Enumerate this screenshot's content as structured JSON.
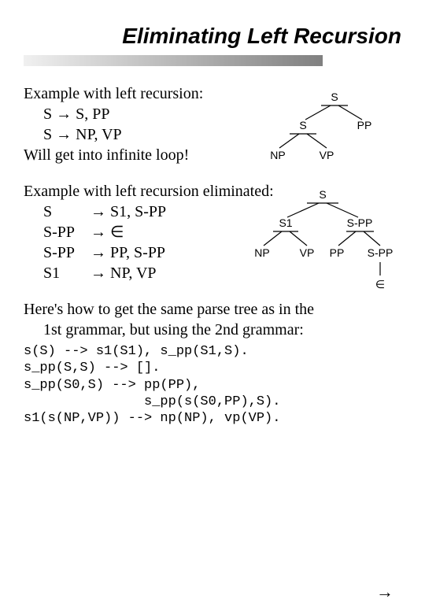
{
  "title": "Eliminating Left Recursion",
  "section1": {
    "heading": "Example with left recursion:",
    "rules": [
      {
        "lhs": "S",
        "rhs": "S, PP"
      },
      {
        "lhs": "S",
        "rhs": "NP, VP"
      }
    ],
    "footer": "Will get into infinite loop!"
  },
  "tree1": {
    "n1": "S",
    "n2": "S",
    "n3": "PP",
    "n4": "NP",
    "n5": "VP"
  },
  "section2": {
    "heading": "Example with left recursion eliminated:",
    "rules": [
      {
        "lhs": "S",
        "rhs": "S1, S-PP"
      },
      {
        "lhs": "S-PP",
        "rhs": "∈"
      },
      {
        "lhs": "S-PP",
        "rhs": "PP, S-PP"
      },
      {
        "lhs": "S1",
        "rhs": "NP, VP"
      }
    ]
  },
  "tree2": {
    "n1": "S",
    "n2": "S1",
    "n3": "S-PP",
    "n4": "NP",
    "n5": "VP",
    "n6": "PP",
    "n7": "S-PP",
    "n8": "∈"
  },
  "section3": {
    "heading_a": "Here's how to get the same parse tree as in the",
    "heading_b": "1st grammar, but using the 2nd grammar:"
  },
  "code": {
    "l1": "s(S) --> s1(S1), s_pp(S1,S).",
    "l2": "s_pp(S,S) --> [].",
    "l3": "s_pp(S0,S) --> pp(PP),",
    "l4": "               s_pp(s(S0,PP),S).",
    "l5": "s1(s(NP,VP)) --> np(NP), vp(VP)."
  },
  "symbols": {
    "arrow": "→",
    "nav_arrow": "→"
  }
}
